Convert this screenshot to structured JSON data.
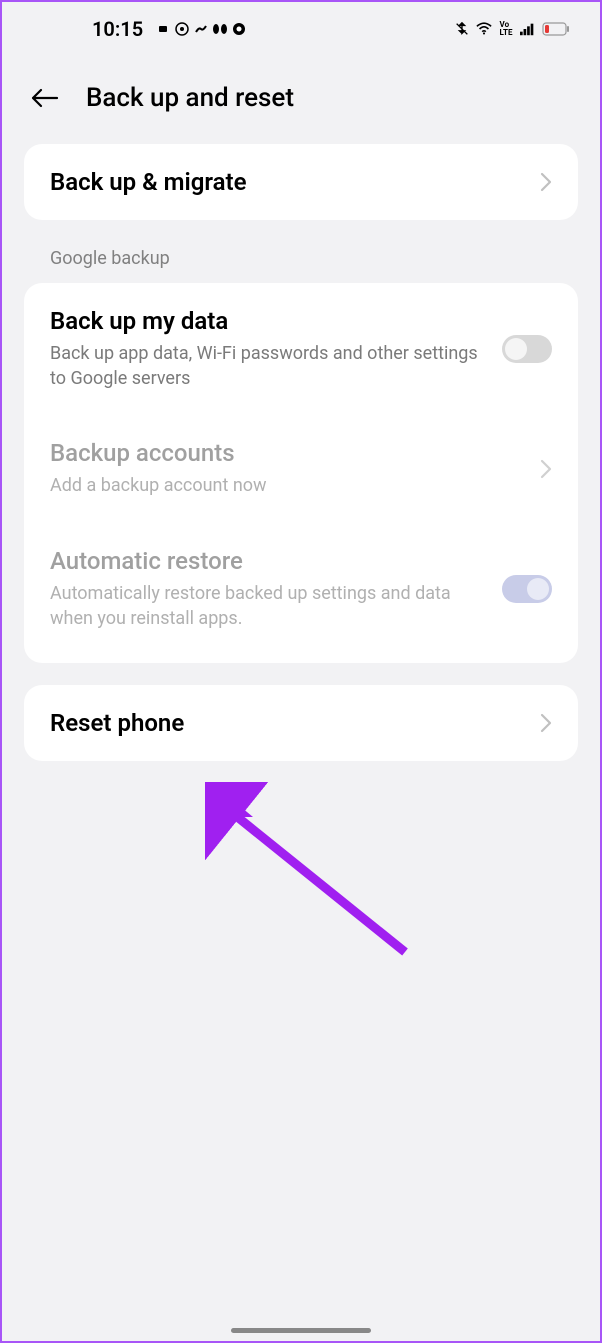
{
  "statusBar": {
    "time": "10:15"
  },
  "header": {
    "title": "Back up and reset"
  },
  "backupMigrate": {
    "title": "Back up & migrate"
  },
  "sectionLabel": "Google backup",
  "backupMyData": {
    "title": "Back up my data",
    "subtitle": "Back up app data, Wi-Fi passwords and other settings to Google servers"
  },
  "backupAccounts": {
    "title": "Backup accounts",
    "subtitle": "Add a backup account now"
  },
  "automaticRestore": {
    "title": "Automatic restore",
    "subtitle": "Automatically restore backed up settings and data when you reinstall apps."
  },
  "resetPhone": {
    "title": "Reset phone"
  }
}
